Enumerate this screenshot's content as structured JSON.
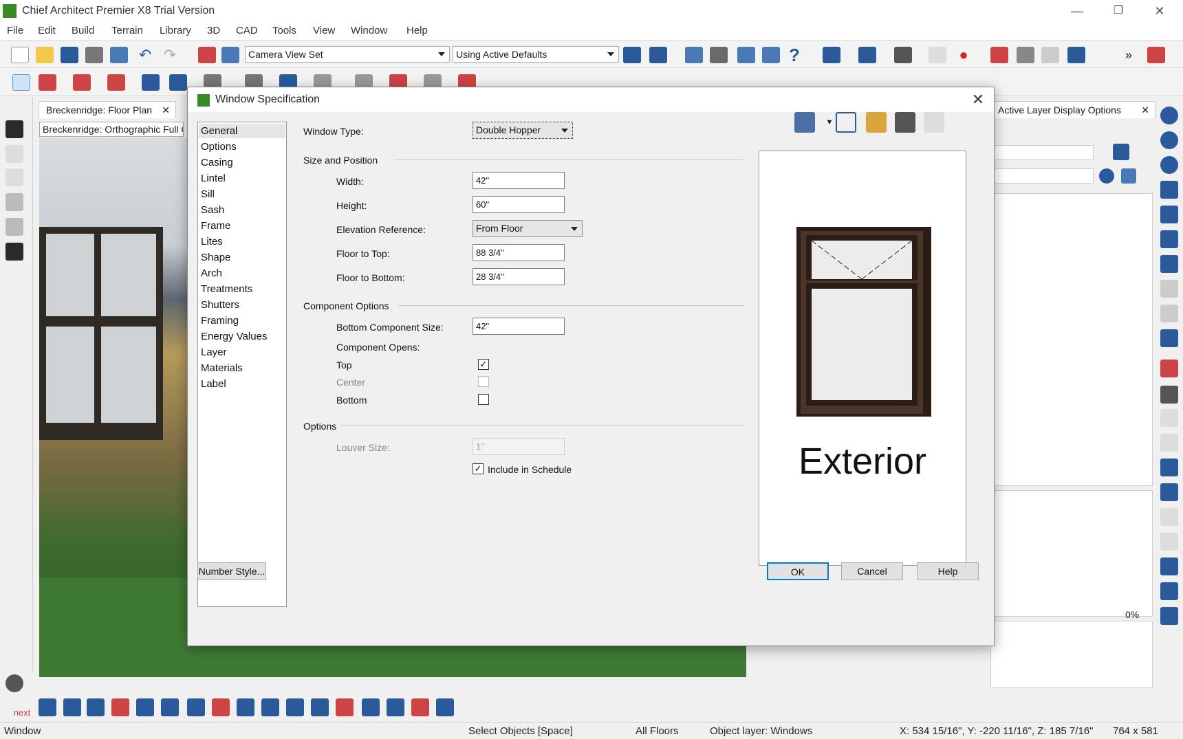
{
  "app": {
    "title": "Chief Architect Premier X8 Trial Version",
    "minimize": "—",
    "restore": "❐",
    "close": "✕"
  },
  "menu": [
    "File",
    "Edit",
    "Build",
    "Terrain",
    "Library",
    "3D",
    "CAD",
    "Tools",
    "View",
    "Window",
    "Help"
  ],
  "toolbar": {
    "camera_view_set": "Camera View Set",
    "defaults": "Using Active Defaults"
  },
  "tabs": {
    "floor_plan": "Breckenridge: Floor Plan",
    "close": "✕",
    "ortho": "Breckenridge: Orthographic Full C",
    "layer_display": "Active Layer Display Options"
  },
  "dialog": {
    "title": "Window Specification",
    "close": "✕",
    "nav": [
      "General",
      "Options",
      "Casing",
      "Lintel",
      "Sill",
      "Sash",
      "Frame",
      "Lites",
      "Shape",
      "Arch",
      "Treatments",
      "Shutters",
      "Framing",
      "Energy Values",
      "Layer",
      "Materials",
      "Label"
    ],
    "window_type_label": "Window Type:",
    "window_type_value": "Double Hopper",
    "size_position": {
      "section": "Size and Position",
      "width_label": "Width:",
      "width_value": "42\"",
      "height_label": "Height:",
      "height_value": "60\"",
      "elev_ref_label": "Elevation Reference:",
      "elev_ref_value": "From Floor",
      "floor_top_label": "Floor to Top:",
      "floor_top_value": "88 3/4\"",
      "floor_bottom_label": "Floor to Bottom:",
      "floor_bottom_value": "28 3/4\""
    },
    "component": {
      "section": "Component Options",
      "bottom_size_label": "Bottom Component Size:",
      "bottom_size_value": "42\"",
      "opens_label": "Component Opens:",
      "top_label": "Top",
      "top_checked": "✓",
      "center_label": "Center",
      "bottom_label": "Bottom"
    },
    "options": {
      "section": "Options",
      "louver_label": "Louver Size:",
      "louver_value": "1\"",
      "include_schedule_label": "Include in Schedule",
      "include_checked": "✓"
    },
    "preview_caption": "Exterior",
    "number_style": "Number Style...",
    "ok": "OK",
    "cancel": "Cancel",
    "help": "Help"
  },
  "right_panel": {
    "percent": "0%"
  },
  "bottom_tools": {
    "next": "next"
  },
  "status": {
    "mode": "Window",
    "action": "Select Objects [Space]",
    "floors": "All Floors",
    "layer": "Object layer: Windows",
    "coords": "X: 534 15/16\", Y: -220 11/16\", Z: 185 7/16\"",
    "size": "764 x 581"
  },
  "colors": {
    "frame": "#3d2b22",
    "accent": "#0078d7",
    "brand": "#3b8a2a"
  }
}
